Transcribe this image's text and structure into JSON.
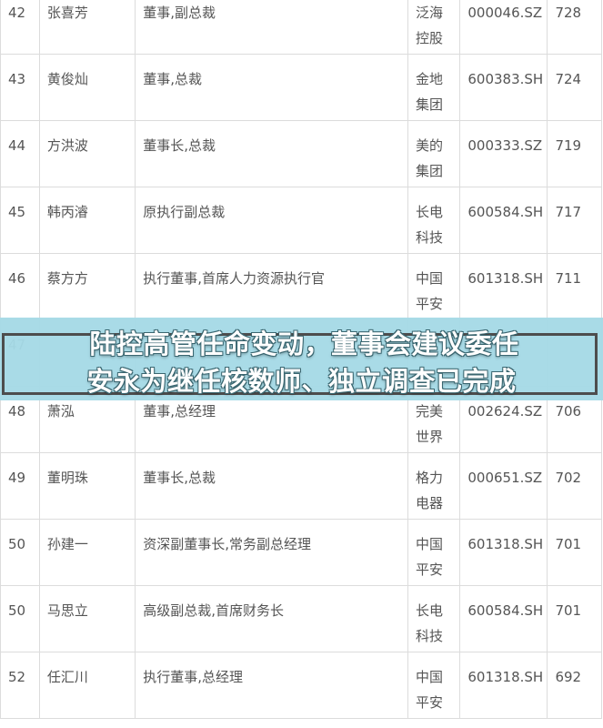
{
  "rows": [
    {
      "rank": "42",
      "name": "张喜芳",
      "title": "董事,副总裁",
      "company": [
        "泛海",
        "控股"
      ],
      "code": "000046.SZ",
      "value": "728"
    },
    {
      "rank": "43",
      "name": "黄俊灿",
      "title": "董事,总裁",
      "company": [
        "金地",
        "集团"
      ],
      "code": "600383.SH",
      "value": "724"
    },
    {
      "rank": "44",
      "name": "方洪波",
      "title": "董事长,总裁",
      "company": [
        "美的",
        "集团"
      ],
      "code": "000333.SZ",
      "value": "719"
    },
    {
      "rank": "45",
      "name": "韩丙濬",
      "title": "原执行副总裁",
      "company": [
        "长电",
        "科技"
      ],
      "code": "600584.SH",
      "value": "717"
    },
    {
      "rank": "46",
      "name": "蔡方方",
      "title": "执行董事,首席人力资源执行官",
      "company": [
        "中国",
        "平安"
      ],
      "code": "601318.SH",
      "value": "711"
    },
    {
      "rank": "47",
      "name": "",
      "title": "",
      "company": [
        "",
        ""
      ],
      "code": "",
      "value": ""
    },
    {
      "rank": "48",
      "name": "萧泓",
      "title": "董事,总经理",
      "company": [
        "完美",
        "世界"
      ],
      "code": "002624.SZ",
      "value": "706"
    },
    {
      "rank": "49",
      "name": "董明珠",
      "title": "董事长,总裁",
      "company": [
        "格力",
        "电器"
      ],
      "code": "000651.SZ",
      "value": "702"
    },
    {
      "rank": "50",
      "name": "孙建一",
      "title": "资深副董事长,常务副总经理",
      "company": [
        "中国",
        "平安"
      ],
      "code": "601318.SH",
      "value": "701"
    },
    {
      "rank": "50",
      "name": "马思立",
      "title": "高级副总裁,首席财务长",
      "company": [
        "长电",
        "科技"
      ],
      "code": "600584.SH",
      "value": "701"
    },
    {
      "rank": "52",
      "name": "任汇川",
      "title": "执行董事,总经理",
      "company": [
        "中国",
        "平安"
      ],
      "code": "601318.SH",
      "value": "692"
    }
  ],
  "banner": {
    "line1": "陆控高管任命变动，董事会建议委任",
    "line2": "安永为继任核数师、独立调查已完成",
    "background": "#a6dae6",
    "frame_color": "#4d4d4d"
  },
  "colors": {
    "text": "#555555",
    "border": "#dcdcdc"
  }
}
